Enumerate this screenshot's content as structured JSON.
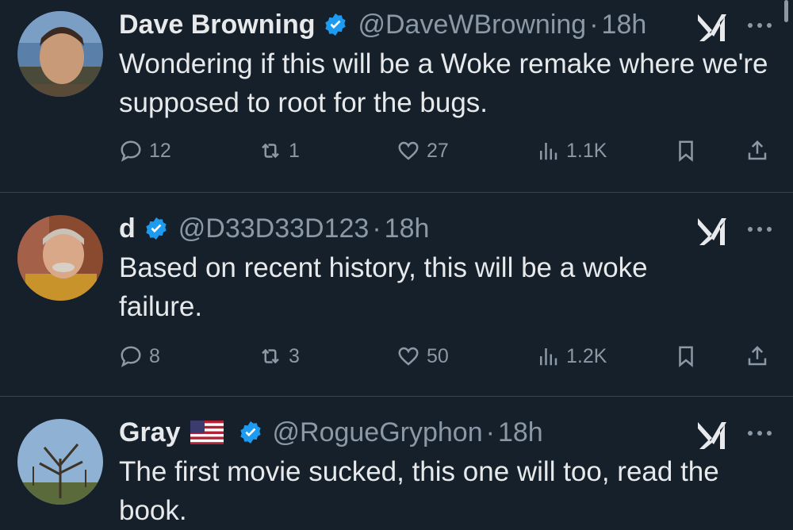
{
  "colors": {
    "background": "#15202b",
    "text": "#e7e9ea",
    "muted": "#8b98a5",
    "verified": "#1d9bf0",
    "divider": "#38444d"
  },
  "tweets": [
    {
      "name": "Dave Browning",
      "handle": "@DaveWBrowning",
      "separator": "·",
      "time": "18h",
      "verified": true,
      "text": "Wondering if this will be a Woke remake where we're supposed to root for the bugs.",
      "replies": "12",
      "reposts": "1",
      "likes": "27",
      "views": "1.1K"
    },
    {
      "name": "d",
      "handle": "@D33D33D123",
      "separator": "·",
      "time": "18h",
      "verified": true,
      "text": "Based on recent history, this will be a woke failure.",
      "replies": "8",
      "reposts": "3",
      "likes": "50",
      "views": "1.2K"
    },
    {
      "name": "Gray",
      "flag": "us-flag-icon",
      "handle": "@RogueGryphon",
      "separator": "·",
      "time": "18h",
      "verified": true,
      "text": "The first movie sucked, this one will too, read the book."
    }
  ]
}
